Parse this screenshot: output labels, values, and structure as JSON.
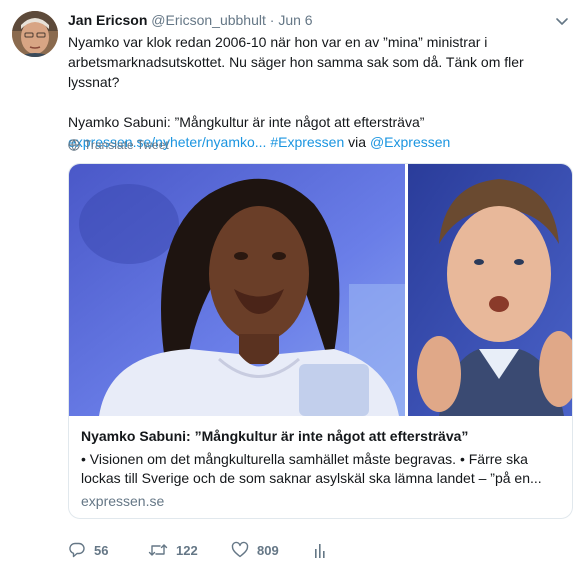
{
  "tweet": {
    "author_name": "Jan Ericson",
    "author_handle": "@Ericson_ubbhult",
    "separator": "·",
    "date": "Jun 6",
    "text_line1": "Nyamko var klok redan 2006-10 när hon var en av ”mina” ministrar i",
    "text_line2": "arbetsmarknadsutskottet. Nu säger hon samma sak som då. Tänk om fler lyssnat?",
    "headline": "Nyamko Sabuni: ”Mångkultur är inte något att eftersträva”",
    "url": "expressen.se/nyheter/nyamko...",
    "hashtag": "#Expressen",
    "via": "via",
    "mention": "@Expressen"
  },
  "translate_label": "Translate Tweet",
  "card": {
    "title": "Nyamko Sabuni: ”Mångkultur är inte något att eftersträva”",
    "description": "• Visionen om det mångkulturella samhället måste begravas. • Färre ska lockas till Sverige och de som saknar asylskäl ska lämna landet – ”på en...",
    "domain": "expressen.se"
  },
  "actions": {
    "replies": "56",
    "retweets": "122",
    "likes": "809"
  },
  "colors": {
    "link": "#1b95e0",
    "muted": "#657786",
    "text": "#14171a",
    "border": "#e1e8ed"
  },
  "icons": {
    "reply": "reply-icon",
    "retweet": "retweet-icon",
    "like": "heart-icon",
    "analytics": "analytics-icon",
    "globe": "globe-icon",
    "caret": "chevron-down-icon"
  }
}
